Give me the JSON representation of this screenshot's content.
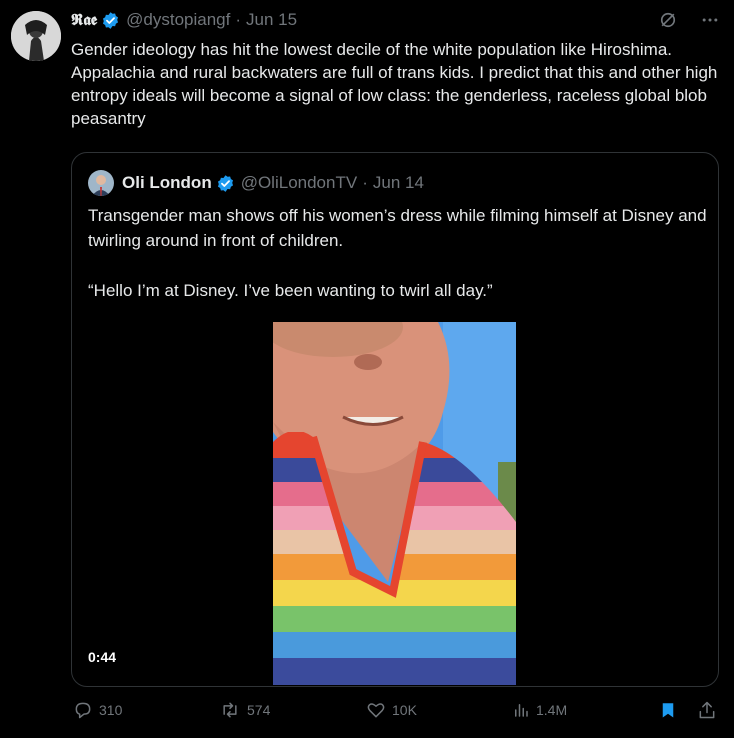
{
  "tweet": {
    "author_name": "𝕽𝖆𝖊",
    "handle": "@dystopiangf",
    "date": "Jun 15",
    "text": "Gender ideology has hit the lowest decile of the white population like Hiroshima. Appalachia and rural backwaters are full of trans kids. I predict that this and other high entropy ideals will become a signal of low class: the genderless, raceless global blob peasantry"
  },
  "quote": {
    "author_name": "Oli London",
    "handle": "@OliLondonTV",
    "date": "Jun 14",
    "text_p1": "Transgender man shows off his women’s dress while filming himself at Disney and twirling around in front of children.",
    "text_p2": "“Hello I’m at Disney. I’ve been wanting to twirl all day.”",
    "video_duration": "0:44"
  },
  "actions": {
    "replies": "310",
    "reposts": "574",
    "likes": "10K",
    "views": "1.4M"
  },
  "icons": [
    "grok-icon",
    "more-icon",
    "reply-icon",
    "repost-icon",
    "like-icon",
    "views-icon",
    "bookmark-icon",
    "share-icon"
  ],
  "colors": {
    "verified": "#1d9bf0",
    "muted": "#71767b",
    "bookmark_active": "#1d9bf0"
  }
}
